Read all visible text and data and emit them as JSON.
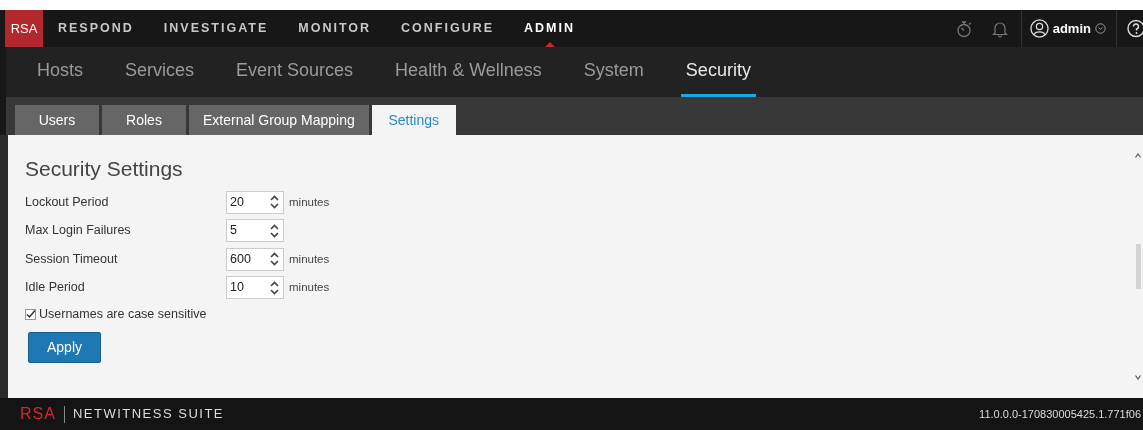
{
  "top_nav": {
    "logo": "RSA",
    "items": [
      {
        "label": "RESPOND",
        "selected": false
      },
      {
        "label": "INVESTIGATE",
        "selected": false
      },
      {
        "label": "MONITOR",
        "selected": false
      },
      {
        "label": "CONFIGURE",
        "selected": false
      },
      {
        "label": "ADMIN",
        "selected": true
      }
    ],
    "user": "admin"
  },
  "sub_nav": [
    {
      "label": "Hosts",
      "selected": false
    },
    {
      "label": "Services",
      "selected": false
    },
    {
      "label": "Event Sources",
      "selected": false
    },
    {
      "label": "Health & Wellness",
      "selected": false
    },
    {
      "label": "System",
      "selected": false
    },
    {
      "label": "Security",
      "selected": true
    }
  ],
  "tabs": [
    {
      "label": "Users",
      "selected": false
    },
    {
      "label": "Roles",
      "selected": false
    },
    {
      "label": "External Group Mapping",
      "selected": false
    },
    {
      "label": "Settings",
      "selected": true
    }
  ],
  "settings": {
    "title": "Security Settings",
    "fields": [
      {
        "label": "Lockout Period",
        "value": "20",
        "unit": "minutes"
      },
      {
        "label": "Max Login Failures",
        "value": "5"
      },
      {
        "label": "Session Timeout",
        "value": "600",
        "unit": "minutes"
      },
      {
        "label": "Idle Period",
        "value": "10",
        "unit": "minutes"
      }
    ],
    "checkbox": {
      "label": "Usernames are case sensitive",
      "checked": true
    },
    "button": "Apply"
  },
  "footer": {
    "logo": "RSA",
    "product": "NETWITNESS SUITE",
    "version": "11.0.0.0-170830005425.1.771f06"
  }
}
